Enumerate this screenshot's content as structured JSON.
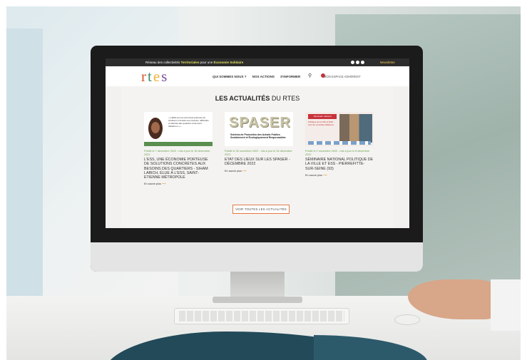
{
  "topbar": {
    "text_pre": "Réseau des collectivités ",
    "text_bold": "Territoriales",
    "text_mid": " pour une ",
    "text_bold2": "Économie Solidaire",
    "newsletter": "Newsletter"
  },
  "logo": {
    "r": "r",
    "t": "t",
    "e": "e",
    "s": "s"
  },
  "nav": {
    "items": [
      "QUI SOMMES NOUS ?",
      "NOS ACTIONS",
      "S'INFORMER"
    ],
    "espace_label": "MON ESPACE ADHÉRENT"
  },
  "section": {
    "title_bold": "LES ACTUALITÉS",
    "title_rest": " DU RTES"
  },
  "cards": [
    {
      "meta": "Publié le 7 décembre 2022 - mis à jour le 16 décembre 2022",
      "title": "L'ESS, UNE ÉCONOMIE PORTEUSE DE SOLUTIONS CONCRÈTES AUX BESOINS DES QUARTIERS - SIHAM LABICH, ÉLUE À L'ESS, SAINT-ETIENNE MÉTROPOLE",
      "more": "En savoir plus",
      "quote": "« L'ESS est une économie porteuse de solutions concrètes aux besoins, difficultés et attentes des quartiers et de leurs habitant·e·s »"
    },
    {
      "meta": "Publié le 30 novembre 2022 - mis à jour le 15 décembre 2022",
      "title": "ETAT DES LIEUX SUR LES SPASER - DÉCEMBRE 2022",
      "more": "En savoir plus",
      "logo_text": "SPASER",
      "sub": "Schéma de Promotion des Achats Publics Socialement et Écologiquement Responsables"
    },
    {
      "meta": "Publié le 2 novembre 2022 - mis à jour le 8 décembre 2022",
      "title": "SÉMINAIRE NATIONAL POLITIQUE DE LA VILLE ET ESS - PIERREFITTE-SUR-SEINE (93)",
      "more": "En savoir plus",
      "tag": "Séminaire national",
      "txt": "Politique de la Ville & ESS : vers de nouvelles alliances"
    }
  ],
  "actions": {
    "all_news": "VOIR TOUTES LES ACTUALITÉS"
  },
  "colors": {
    "accent": "#e27a46",
    "meta_green": "#6a9e4f",
    "topbar": "#2d2d2d",
    "wave": "#234a59"
  }
}
